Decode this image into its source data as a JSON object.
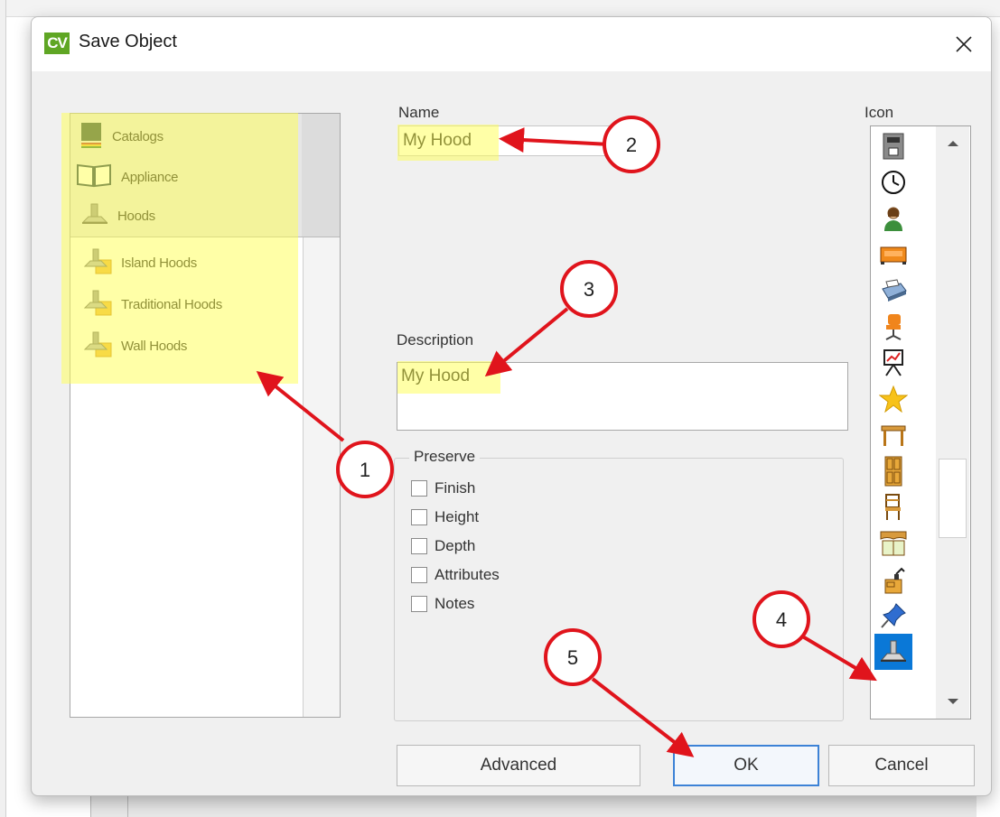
{
  "dialog": {
    "logo": "CV",
    "title": "Save Object",
    "close_glyph": "✕"
  },
  "tree": {
    "header_items": [
      {
        "label": "Catalogs",
        "icon": "catalogs-icon"
      },
      {
        "label": "Appliance",
        "icon": "open-book-icon"
      },
      {
        "label": "Hoods",
        "icon": "hood-icon"
      }
    ],
    "list_items": [
      {
        "label": "Island Hoods",
        "icon": "hood-folder-icon"
      },
      {
        "label": "Traditional Hoods",
        "icon": "hood-folder-icon"
      },
      {
        "label": "Wall Hoods",
        "icon": "hood-folder-icon"
      }
    ]
  },
  "form": {
    "name_label": "Name",
    "name_value": "My Hood",
    "description_label": "Description",
    "description_value": "My Hood",
    "preserve_legend": "Preserve",
    "preserve_options": [
      {
        "label": "Finish",
        "checked": false
      },
      {
        "label": "Height",
        "checked": false
      },
      {
        "label": "Depth",
        "checked": false
      },
      {
        "label": "Attributes",
        "checked": false
      },
      {
        "label": "Notes",
        "checked": false
      }
    ]
  },
  "icon_picker": {
    "label": "Icon",
    "icons": [
      "coffee-machine-icon",
      "clock-icon",
      "person-icon",
      "sofa-icon",
      "printer-icon",
      "office-chair-icon",
      "presentation-easel-icon",
      "star-icon",
      "table-icon",
      "cabinet-icon",
      "chair-icon",
      "window-valance-icon",
      "desk-lamp-icon",
      "pushpin-icon",
      "range-hood-icon"
    ],
    "selected": "range-hood-icon"
  },
  "buttons": {
    "advanced": "Advanced",
    "ok": "OK",
    "cancel": "Cancel"
  },
  "annotations": [
    "1",
    "2",
    "3",
    "4",
    "5"
  ],
  "colors": {
    "highlight": "#ffff66",
    "marker_red": "#e0141c",
    "accent_blue": "#0a78d7",
    "logo_green": "#5fa624"
  }
}
